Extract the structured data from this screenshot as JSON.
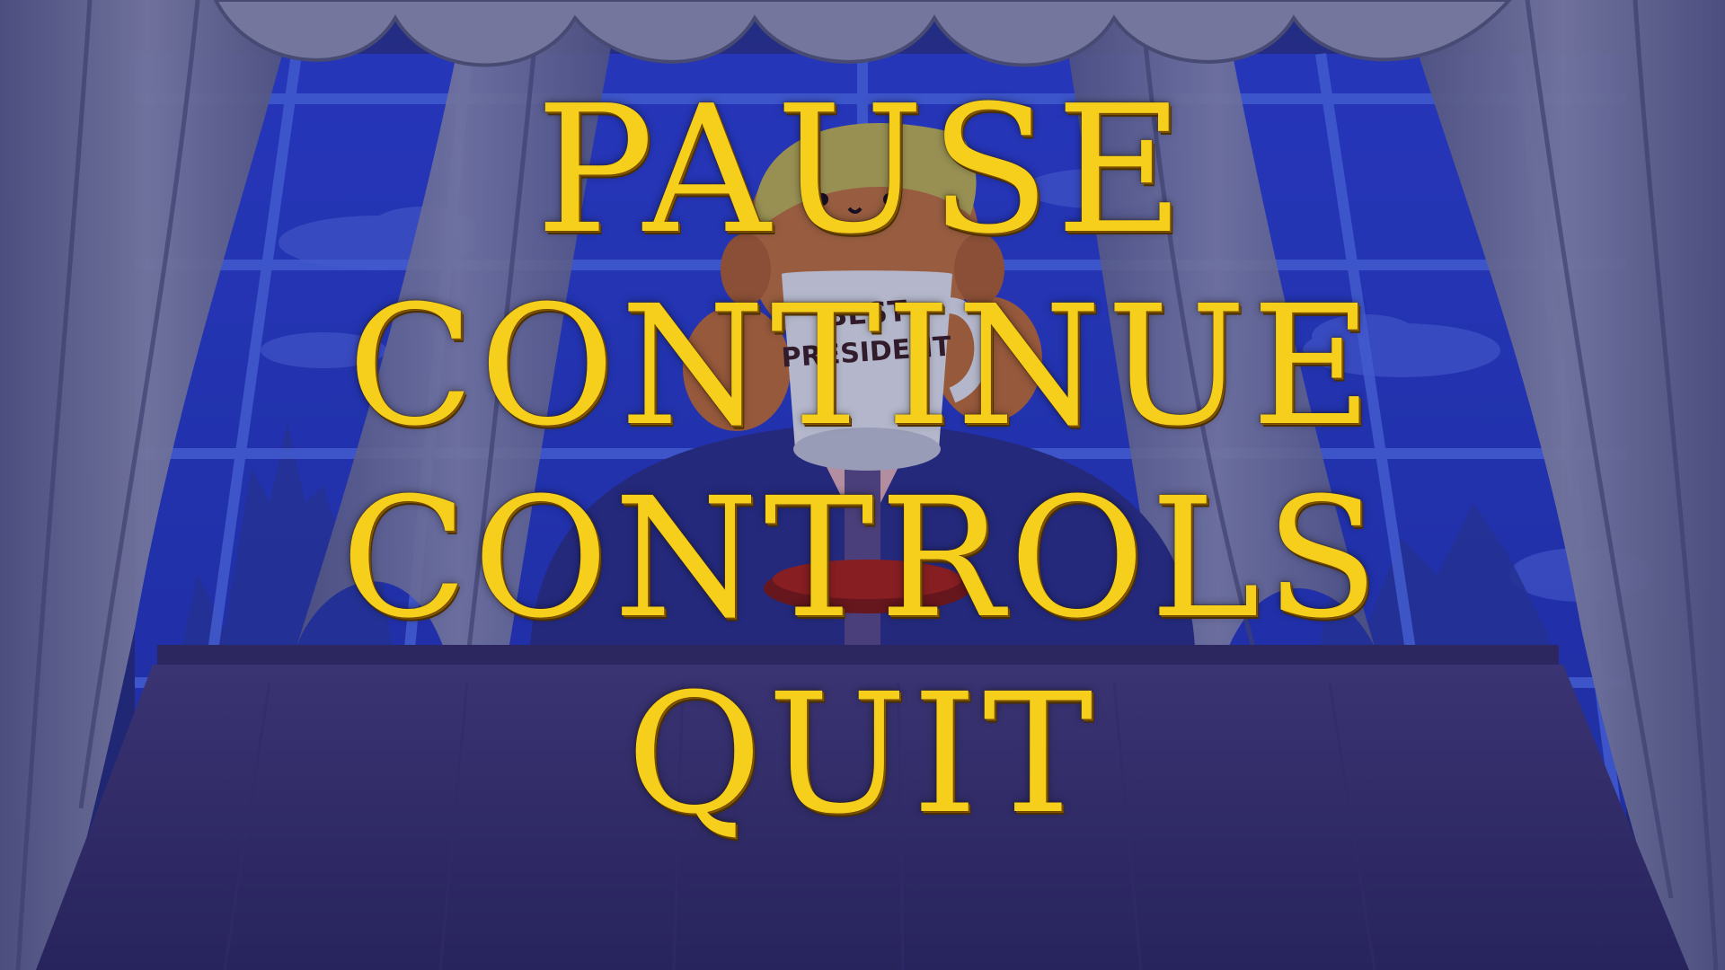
{
  "menu": {
    "title": "PAUSE",
    "options": [
      "CONTINUE",
      "CONTROLS",
      "QUIT"
    ]
  },
  "scene": {
    "mug_text_line1": "BEST",
    "mug_text_line2": "PRESIDENT"
  },
  "colors": {
    "menu_text": "#f6cf1c",
    "night_sky": "#2f3fd1",
    "curtain": "#7e7fa8",
    "desk": "#3b3373",
    "button_red": "#a3221e"
  }
}
